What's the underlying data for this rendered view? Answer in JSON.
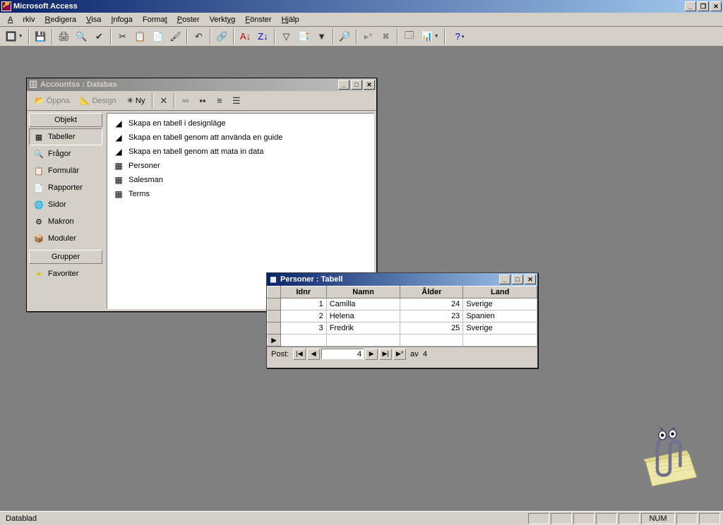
{
  "app": {
    "title": "Microsoft Access"
  },
  "menu": {
    "arkiv": "Arkiv",
    "redigera": "Redigera",
    "visa": "Visa",
    "infoga": "Infoga",
    "format": "Format",
    "poster": "Poster",
    "verktyg": "Verktyg",
    "fonster": "Fönster",
    "hjalp": "Hjälp"
  },
  "dbwindow": {
    "title": "Accountss : Databas",
    "toolbar": {
      "open": "Öppna",
      "design": "Design",
      "new": "Ny"
    },
    "objects_header": "Objekt",
    "groups_header": "Grupper",
    "sidebar": [
      "Tabeller",
      "Frågor",
      "Formulär",
      "Rapporter",
      "Sidor",
      "Makron",
      "Moduler"
    ],
    "favorites": "Favoriter",
    "items": [
      "Skapa en tabell i designläge",
      "Skapa en tabell genom att använda en guide",
      "Skapa en tabell genom att mata in data",
      "Personer",
      "Salesman",
      "Terms"
    ]
  },
  "tablewindow": {
    "title": "Personer : Tabell",
    "columns": [
      "Idnr",
      "Namn",
      "Ålder",
      "Land"
    ],
    "rows": [
      {
        "idnr": "1",
        "namn": "Camilla",
        "alder": "24",
        "land": "Sverige"
      },
      {
        "idnr": "2",
        "namn": "Helena",
        "alder": "23",
        "land": "Spanien"
      },
      {
        "idnr": "3",
        "namn": "Fredrik",
        "alder": "25",
        "land": "Sverige"
      }
    ],
    "nav": {
      "label": "Post:",
      "current": "4",
      "of_label": "av",
      "total": "4"
    }
  },
  "statusbar": {
    "mode": "Datablad",
    "num": "NUM"
  }
}
